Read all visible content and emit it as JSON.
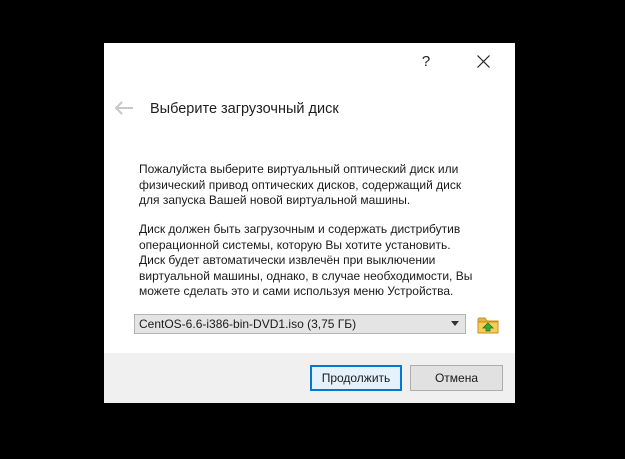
{
  "titlebar": {
    "help_label": "?",
    "close_icon": "close-icon"
  },
  "header": {
    "back_icon": "back-arrow-icon",
    "title": "Выберите загрузочный диск"
  },
  "content": {
    "paragraph1": [
      "Пожалуйста выберите виртуальный оптический диск или",
      "физический привод оптических дисков, содержащий диск",
      "для запуска Вашей новой виртуальной машины."
    ],
    "paragraph2": [
      "Диск должен быть загрузочным и содержать дистрибутив",
      "операционной системы, которую Вы хотите установить.",
      "Диск будет автоматически извлечён при выключении",
      "виртуальной машины, однако, в случае необходимости, Вы",
      "можете сделать это и сами используя меню Устройства."
    ]
  },
  "disk_selector": {
    "selected": "CentOS-6.6-i386-bin-DVD1.iso (3,75 ГБ)",
    "browse_icon": "folder-icon"
  },
  "buttons": {
    "continue_label": "Продолжить",
    "cancel_label": "Отмена"
  },
  "colors": {
    "background": "#000000",
    "dialog": "#ffffff",
    "footer": "#f0f0f0",
    "accent": "#0078d7",
    "folder": "#f4c44e",
    "folder_arrow": "#3aa83a"
  }
}
